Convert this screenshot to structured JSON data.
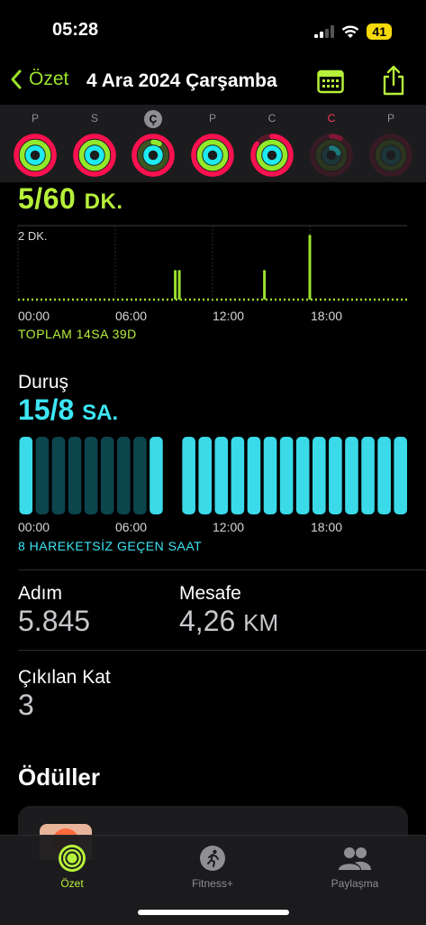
{
  "status": {
    "time": "05:28",
    "battery": "41"
  },
  "nav": {
    "back_label": "Özet",
    "title": "4 Ara 2024 Çarşamba"
  },
  "week": [
    {
      "letter": "P",
      "move": 1.0,
      "exercise": 1.0,
      "stand": 1.0
    },
    {
      "letter": "S",
      "move": 1.0,
      "exercise": 1.0,
      "stand": 1.0
    },
    {
      "letter": "Ç",
      "move": 1.0,
      "exercise": 0.08,
      "stand": 1.0,
      "today": true
    },
    {
      "letter": "P",
      "move": 1.0,
      "exercise": 1.0,
      "stand": 1.0
    },
    {
      "letter": "C",
      "move": 0.85,
      "exercise": 1.0,
      "stand": 1.0
    },
    {
      "letter": "C",
      "move": 0.08,
      "exercise": 0.0,
      "stand": 0.2,
      "red": true,
      "dim": true
    },
    {
      "letter": "P",
      "move": 0.0,
      "exercise": 0.0,
      "stand": 0.0,
      "dim": true
    }
  ],
  "exercise": {
    "value": "5/60",
    "unit": "DK.",
    "max_label": "2 DK.",
    "axis": [
      "00:00",
      "06:00",
      "12:00",
      "18:00"
    ],
    "total": "TOPLAM 14SA 39D",
    "spikes": [
      {
        "hour": 9.7,
        "minutes": 0.8
      },
      {
        "hour": 9.95,
        "minutes": 0.8
      },
      {
        "hour": 15.2,
        "minutes": 0.8
      },
      {
        "hour": 18.0,
        "minutes": 1.75
      }
    ],
    "color": "#9be22d"
  },
  "stand": {
    "title": "Duruş",
    "value": "15/8",
    "unit": "SA.",
    "axis": [
      "00:00",
      "06:00",
      "12:00",
      "18:00"
    ],
    "idle": "8 HAREKETSİZ GEÇEN SAAT",
    "hours": [
      1,
      0,
      0,
      0,
      0,
      0,
      0,
      0,
      1,
      0,
      1,
      1,
      1,
      1,
      1,
      1,
      1,
      1,
      1,
      1,
      1,
      1,
      1,
      1
    ],
    "color": "#3de6f5"
  },
  "stats": {
    "steps_label": "Adım",
    "steps_value": "5.845",
    "distance_label": "Mesafe",
    "distance_value": "4,26",
    "distance_unit": "KM",
    "floors_label": "Çıkılan Kat",
    "floors_value": "3"
  },
  "awards_title": "Ödüller",
  "tabs": {
    "summary": "Özet",
    "fitness": "Fitness+",
    "sharing": "Paylaşma"
  },
  "colors": {
    "move": "#fa114f",
    "exercise": "#92e82a",
    "stand": "#1eeaef",
    "accent": "#b6f03a"
  }
}
